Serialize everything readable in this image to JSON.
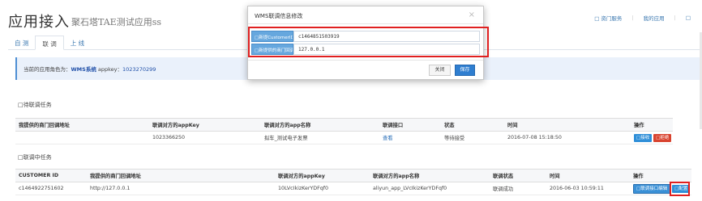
{
  "header": {
    "title": "应用接入",
    "subtitle": "聚石塔TAE测试应用ss",
    "links": [
      "□ 资门服务",
      "我的应用",
      "□"
    ]
  },
  "tabs": [
    {
      "label": "自 测",
      "active": false
    },
    {
      "label": "联 调",
      "active": true
    },
    {
      "label": "上 线",
      "active": false
    }
  ],
  "info": {
    "prefix": "当前的应用角色为：",
    "role": "WMS系统",
    "appkey_label": "appkey：",
    "appkey": "1023270299"
  },
  "pending": {
    "section_label": "□待联调任务",
    "headers": [
      "我提供的商门回调地址",
      "联调对方的appKey",
      "联调对方的app名称",
      "联调接口",
      "状态",
      "时间",
      "操作"
    ],
    "rows": [
      {
        "addr": "",
        "appkey": "1023366250",
        "appname": "拟车_测试电子发票",
        "api": "查看",
        "status": "等待接受",
        "time": "2016-07-08 15:18:50",
        "actions": [
          "□接收",
          "□拒绝"
        ]
      }
    ]
  },
  "inprogress": {
    "section_label": "□联调中任务",
    "headers": [
      "CUSTOMER ID",
      "我提供的商门回调地址",
      "联调对方的appKey",
      "联调对方的app名称",
      "联调状态",
      "时间",
      "操作"
    ],
    "rows": [
      {
        "cid": "c1464922751602",
        "addr": "http://127.0.0.1",
        "appkey": "10LVcIkizKerYDFqf0",
        "appname": "aliyun_app_LVcIkizKerYDFqf0",
        "status": "联调成功",
        "time": "2016-06-03 10:59:11",
        "actions": [
          "□联调接口编辑",
          "□配置"
        ]
      }
    ]
  },
  "modal": {
    "title": "WMS联调信息修改",
    "close_glyph": "×",
    "fields": [
      {
        "label": "□新提CustomerID",
        "value": "c1464851503919"
      },
      {
        "label": "□新提供的商门回调地址",
        "value": "127.0.0.1"
      }
    ],
    "close_label": "关闭",
    "save_label": "保存"
  }
}
